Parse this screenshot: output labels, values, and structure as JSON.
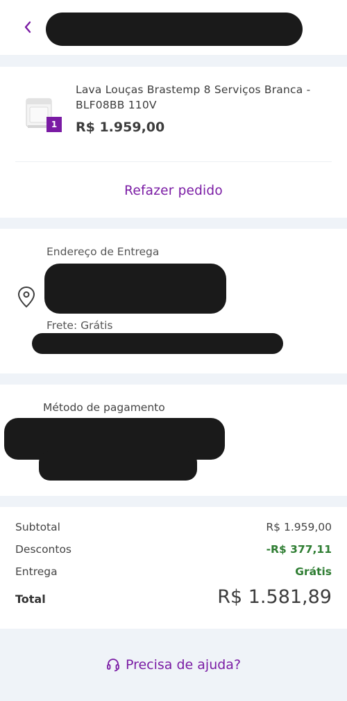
{
  "header": {
    "back_icon": "chevron-left-icon"
  },
  "product": {
    "name": "Lava Louças Brastemp 8 Serviços Branca - BLF08BB 110V",
    "price": "R$ 1.959,00",
    "quantity": "1",
    "reorder_label": "Refazer pedido"
  },
  "address": {
    "label": "Endereço de Entrega",
    "freight": "Frete: Grátis",
    "icon": "location-pin-icon"
  },
  "payment": {
    "label": "Método de pagamento"
  },
  "totals": {
    "subtotal_label": "Subtotal",
    "subtotal_value": "R$ 1.959,00",
    "discount_label": "Descontos",
    "discount_value": "-R$ 377,11",
    "delivery_label": "Entrega",
    "delivery_value": "Grátis",
    "total_label": "Total",
    "total_value": "R$ 1.581,89"
  },
  "help": {
    "label": "Precisa de ajuda?",
    "icon": "headset-icon"
  },
  "colors": {
    "accent": "#7a1ba4",
    "success": "#2e7d32",
    "section_bg": "#eff3f8"
  }
}
